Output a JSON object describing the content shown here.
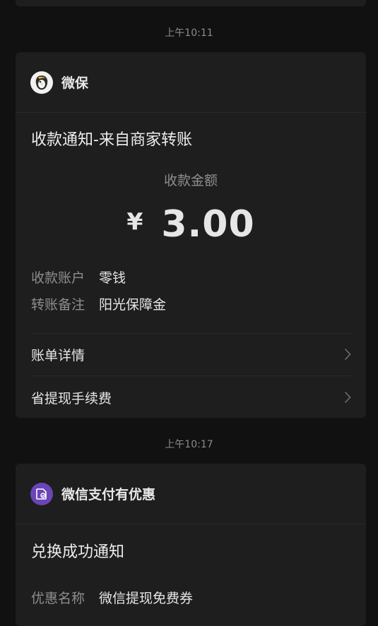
{
  "messages": [
    {
      "time": "上午10:11",
      "app_name": "微保",
      "title": "收款通知-来自商家转账",
      "amount_label": "收款金额",
      "currency_symbol": "¥",
      "amount_value": "3.00",
      "fields": [
        {
          "key": "收款账户",
          "value": "零钱"
        },
        {
          "key": "转账备注",
          "value": "阳光保障金"
        }
      ],
      "links": [
        {
          "label": "账单详情"
        },
        {
          "label": "省提现手续费"
        }
      ]
    },
    {
      "time": "上午10:17",
      "app_name": "微信支付有优惠",
      "title": "兑换成功通知",
      "fields": [
        {
          "key": "优惠名称",
          "value": "微信提现免费券"
        }
      ]
    }
  ],
  "colors": {
    "background": "#111111",
    "card": "#1e1e1e",
    "purple_icon": "#6a45b7"
  },
  "icons": [
    "weibao-logo-icon",
    "coupon-icon",
    "chevron-right-icon"
  ]
}
